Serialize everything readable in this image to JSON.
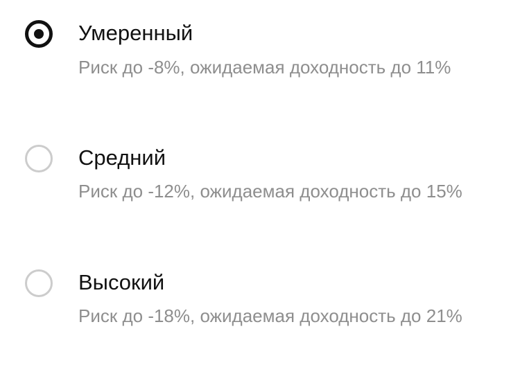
{
  "risk_options": [
    {
      "title": "Умеренный",
      "description": "Риск до -8%, ожидаемая доходность до 11%",
      "selected": true
    },
    {
      "title": "Средний",
      "description": "Риск до -12%, ожидаемая доходность до 15%",
      "selected": false
    },
    {
      "title": "Высокий",
      "description": "Риск до -18%, ожидаемая доходность до 21%",
      "selected": false
    }
  ],
  "colors": {
    "selected_radio": "#111111",
    "unselected_radio": "#cccccc",
    "title_text": "#111111",
    "description_text": "#8e8e8e"
  }
}
